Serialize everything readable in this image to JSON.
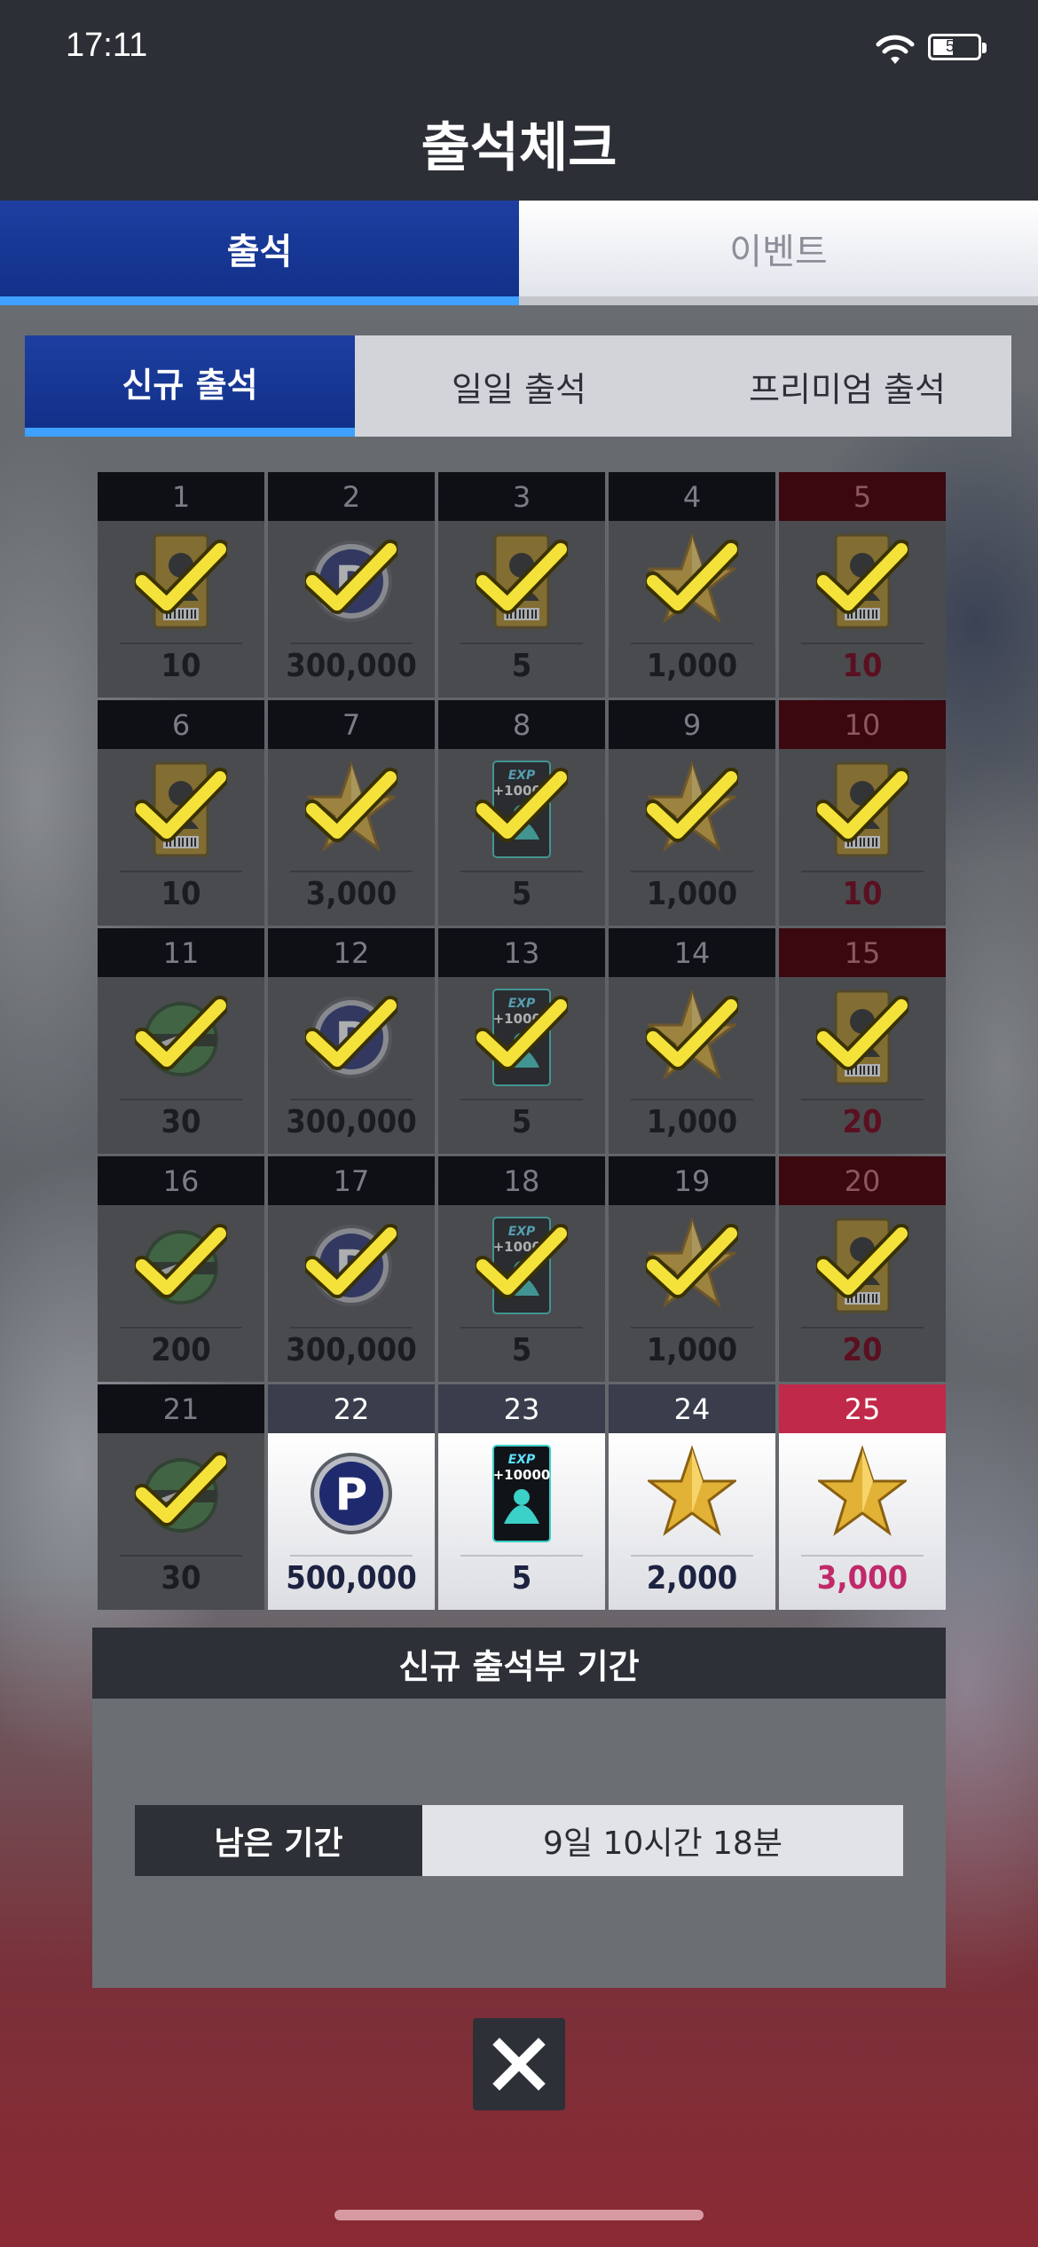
{
  "status_bar": {
    "time": "17:11",
    "battery": "50"
  },
  "header": {
    "title": "출석체크"
  },
  "main_tabs": [
    {
      "label": "출석",
      "active": true
    },
    {
      "label": "이벤트",
      "active": false
    }
  ],
  "sub_tabs": [
    {
      "label": "신규 출석",
      "active": true
    },
    {
      "label": "일일 출석",
      "active": false
    },
    {
      "label": "프리미엄 출석",
      "active": false
    }
  ],
  "days": [
    {
      "day": "1",
      "qty": "10",
      "item": "player-card-icon",
      "claimed": true,
      "special": false
    },
    {
      "day": "2",
      "qty": "300,000",
      "item": "p-coin-icon",
      "claimed": true,
      "special": false
    },
    {
      "day": "3",
      "qty": "5",
      "item": "player-card-icon",
      "claimed": true,
      "special": false
    },
    {
      "day": "4",
      "qty": "1,000",
      "item": "star-icon",
      "claimed": true,
      "special": false
    },
    {
      "day": "5",
      "qty": "10",
      "item": "player-card-icon",
      "claimed": true,
      "special": true
    },
    {
      "day": "6",
      "qty": "10",
      "item": "player-card-icon",
      "claimed": true,
      "special": false
    },
    {
      "day": "7",
      "qty": "3,000",
      "item": "star-icon",
      "claimed": true,
      "special": false
    },
    {
      "day": "8",
      "qty": "5",
      "item": "exp-card-icon",
      "claimed": true,
      "special": false
    },
    {
      "day": "9",
      "qty": "1,000",
      "item": "star-icon",
      "claimed": true,
      "special": false
    },
    {
      "day": "10",
      "qty": "10",
      "item": "player-card-icon",
      "claimed": true,
      "special": true
    },
    {
      "day": "11",
      "qty": "30",
      "item": "ball-icon",
      "claimed": true,
      "special": false
    },
    {
      "day": "12",
      "qty": "300,000",
      "item": "p-coin-icon",
      "claimed": true,
      "special": false
    },
    {
      "day": "13",
      "qty": "5",
      "item": "exp-card-icon",
      "claimed": true,
      "special": false
    },
    {
      "day": "14",
      "qty": "1,000",
      "item": "star-icon",
      "claimed": true,
      "special": false
    },
    {
      "day": "15",
      "qty": "20",
      "item": "player-card-icon",
      "claimed": true,
      "special": true
    },
    {
      "day": "16",
      "qty": "200",
      "item": "ball-icon",
      "claimed": true,
      "special": false
    },
    {
      "day": "17",
      "qty": "300,000",
      "item": "p-coin-icon",
      "claimed": true,
      "special": false
    },
    {
      "day": "18",
      "qty": "5",
      "item": "exp-card-icon",
      "claimed": true,
      "special": false
    },
    {
      "day": "19",
      "qty": "1,000",
      "item": "star-icon",
      "claimed": true,
      "special": false
    },
    {
      "day": "20",
      "qty": "20",
      "item": "player-card-icon",
      "claimed": true,
      "special": true
    },
    {
      "day": "21",
      "qty": "30",
      "item": "ball-icon",
      "claimed": true,
      "special": false
    },
    {
      "day": "22",
      "qty": "500,000",
      "item": "p-coin-icon",
      "claimed": false,
      "special": false
    },
    {
      "day": "23",
      "qty": "5",
      "item": "exp-card-icon",
      "claimed": false,
      "special": false
    },
    {
      "day": "24",
      "qty": "2,000",
      "item": "star-icon",
      "claimed": false,
      "special": false
    },
    {
      "day": "25",
      "qty": "3,000",
      "item": "star-icon",
      "claimed": false,
      "special": true
    }
  ],
  "exp_card_text": {
    "line1": "EXP",
    "line2": "+10000"
  },
  "p_coin_letter": "P",
  "period": {
    "title": "신규 출석부 기간",
    "label": "남은 기간",
    "value": "9일 10시간 18분"
  },
  "colors": {
    "accent_blue": "#11308a",
    "tab_underline": "#3ea0ff",
    "special_red": "#c0294a"
  }
}
